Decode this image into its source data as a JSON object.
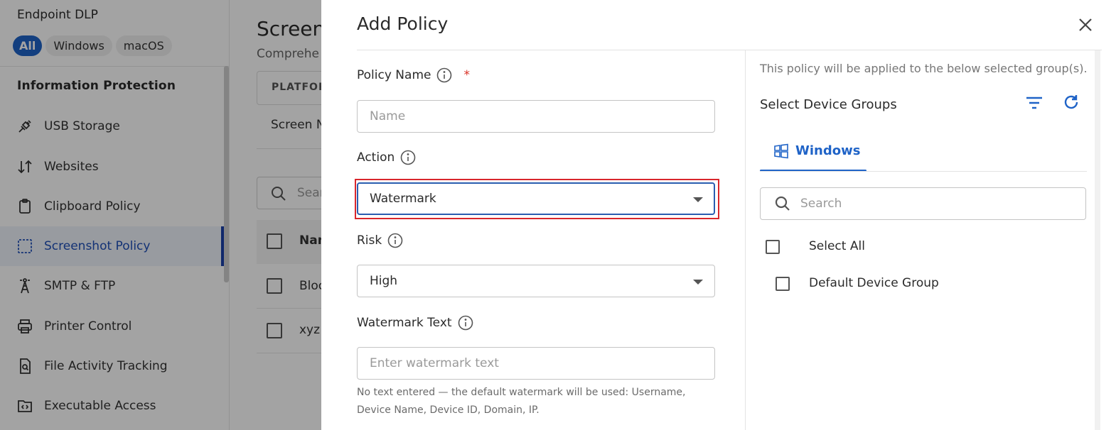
{
  "sidebar": {
    "app_title": "Endpoint DLP",
    "platform_chips": [
      "All",
      "Windows",
      "macOS"
    ],
    "section_title": "Information Protection",
    "items": [
      {
        "label": "USB Storage",
        "icon": "usb-icon"
      },
      {
        "label": "Websites",
        "icon": "sort-arrows-icon"
      },
      {
        "label": "Clipboard Policy",
        "icon": "clipboard-icon"
      },
      {
        "label": "Screenshot Policy",
        "icon": "screenshot-icon",
        "active": true
      },
      {
        "label": "SMTP & FTP",
        "icon": "tower-icon"
      },
      {
        "label": "Printer Control",
        "icon": "printer-icon"
      },
      {
        "label": "File Activity Tracking",
        "icon": "file-search-icon"
      },
      {
        "label": "Executable Access",
        "icon": "executable-icon"
      }
    ]
  },
  "main": {
    "title": "Screen",
    "subtitle": "Comprehe",
    "platform_label": "PLATFOR",
    "tab_label": "Screen N",
    "search_placeholder": "Sear",
    "table_header": "Nam",
    "rows": [
      "Bloc",
      "xyz"
    ]
  },
  "dialog": {
    "title": "Add Policy",
    "policy_name": {
      "label": "Policy Name",
      "required_mark": "*",
      "placeholder": "Name",
      "value": ""
    },
    "action": {
      "label": "Action",
      "value": "Watermark"
    },
    "risk": {
      "label": "Risk",
      "value": "High"
    },
    "watermark_text": {
      "label": "Watermark Text",
      "placeholder": "Enter watermark text",
      "hint": "No text entered — the default watermark will be used: Username, Device Name, Device ID, Domain, IP."
    },
    "right_panel": {
      "applied_note": "This policy will be applied to the below selected group(s).",
      "groups_title": "Select Device Groups",
      "tab_label": "Windows",
      "search_placeholder": "Search",
      "select_all_label": "Select All",
      "groups": [
        "Default Device Group"
      ]
    }
  },
  "colors": {
    "accent": "#1f63c7",
    "active_nav_bar": "#1a3fa8",
    "required": "#d93025",
    "highlight_border": "#d9262c"
  }
}
